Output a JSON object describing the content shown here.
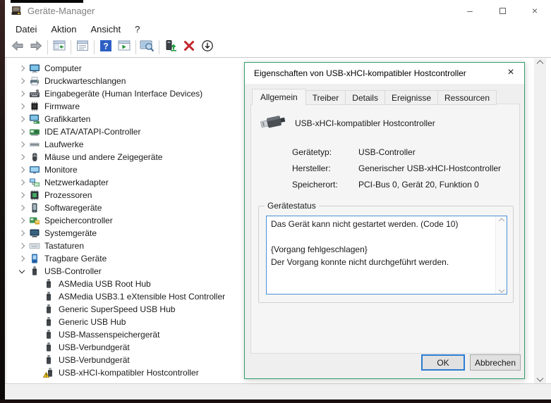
{
  "window": {
    "title": "Geräte-Manager",
    "controls": {
      "minimize": "–",
      "close": "×"
    }
  },
  "menu": {
    "items": [
      "Datei",
      "Aktion",
      "Ansicht",
      "?"
    ]
  },
  "toolbar": {
    "buttons": [
      {
        "type": "button",
        "icon": "back-icon"
      },
      {
        "type": "button",
        "icon": "forward-icon"
      },
      {
        "type": "separator"
      },
      {
        "type": "button",
        "icon": "show-hide-console-tree-icon"
      },
      {
        "type": "separator"
      },
      {
        "type": "button",
        "icon": "properties-icon"
      },
      {
        "type": "separator"
      },
      {
        "type": "button",
        "icon": "help-icon"
      },
      {
        "type": "button",
        "icon": "show-hide-action-pane-icon"
      },
      {
        "type": "separator"
      },
      {
        "type": "button",
        "icon": "scan-hardware-changes-icon"
      },
      {
        "type": "separator"
      },
      {
        "type": "button",
        "icon": "update-driver-icon"
      },
      {
        "type": "button",
        "icon": "uninstall-device-icon"
      },
      {
        "type": "button",
        "icon": "disable-device-icon"
      }
    ]
  },
  "tree": {
    "items": [
      {
        "label": "Computer",
        "icon": "computer-icon",
        "level": 0,
        "expanded": false
      },
      {
        "label": "Druckwarteschlangen",
        "icon": "printer-icon",
        "level": 0,
        "expanded": false
      },
      {
        "label": "Eingabegeräte (Human Interface Devices)",
        "icon": "hid-icon",
        "level": 0,
        "expanded": false
      },
      {
        "label": "Firmware",
        "icon": "firmware-chip-icon",
        "level": 0,
        "expanded": false
      },
      {
        "label": "Grafikkarten",
        "icon": "display-adapter-icon",
        "level": 0,
        "expanded": false
      },
      {
        "label": "IDE ATA/ATAPI-Controller",
        "icon": "ide-controller-icon",
        "level": 0,
        "expanded": false
      },
      {
        "label": "Laufwerke",
        "icon": "disk-drive-icon",
        "level": 0,
        "expanded": false
      },
      {
        "label": "Mäuse und andere Zeigegeräte",
        "icon": "mouse-icon",
        "level": 0,
        "expanded": false
      },
      {
        "label": "Monitore",
        "icon": "monitor-icon",
        "level": 0,
        "expanded": false
      },
      {
        "label": "Netzwerkadapter",
        "icon": "network-adapter-icon",
        "level": 0,
        "expanded": false
      },
      {
        "label": "Prozessoren",
        "icon": "processor-icon",
        "level": 0,
        "expanded": false
      },
      {
        "label": "Softwaregeräte",
        "icon": "software-device-icon",
        "level": 0,
        "expanded": false
      },
      {
        "label": "Speichercontroller",
        "icon": "storage-controller-icon",
        "level": 0,
        "expanded": false
      },
      {
        "label": "Systemgeräte",
        "icon": "system-device-icon",
        "level": 0,
        "expanded": false
      },
      {
        "label": "Tastaturen",
        "icon": "keyboard-icon",
        "level": 0,
        "expanded": false
      },
      {
        "label": "Tragbare Geräte",
        "icon": "portable-device-icon",
        "level": 0,
        "expanded": false
      },
      {
        "label": "USB-Controller",
        "icon": "usb-device-icon",
        "level": 0,
        "expanded": true
      },
      {
        "label": "ASMedia USB Root Hub",
        "icon": "usb-device-icon",
        "level": 1
      },
      {
        "label": "ASMedia USB3.1 eXtensible Host Controller",
        "icon": "usb-device-icon",
        "level": 1
      },
      {
        "label": "Generic SuperSpeed USB Hub",
        "icon": "usb-device-icon",
        "level": 1
      },
      {
        "label": "Generic USB Hub",
        "icon": "usb-device-icon",
        "level": 1
      },
      {
        "label": "USB-Massenspeichergerät",
        "icon": "usb-device-icon",
        "level": 1
      },
      {
        "label": "USB-Verbundgerät",
        "icon": "usb-device-icon",
        "level": 1
      },
      {
        "label": "USB-Verbundgerät",
        "icon": "usb-device-icon",
        "level": 1
      },
      {
        "label": "USB-xHCI-kompatibler Hostcontroller",
        "icon": "usb-warning-icon",
        "level": 1
      }
    ]
  },
  "dialog": {
    "title": "Eigenschaften von USB-xHCI-kompatibler Hostcontroller",
    "close_glyph": "×",
    "tabs": [
      {
        "label": "Allgemein",
        "active": true
      },
      {
        "label": "Treiber",
        "active": false
      },
      {
        "label": "Details",
        "active": false
      },
      {
        "label": "Ereignisse",
        "active": false
      },
      {
        "label": "Ressourcen",
        "active": false
      }
    ],
    "device_name": "USB-xHCI-kompatibler Hostcontroller",
    "device_icon": "usb-connector-icon",
    "fields": [
      {
        "label": "Gerätetyp:",
        "value": "USB-Controller"
      },
      {
        "label": "Hersteller:",
        "value": "Generischer USB-xHCI-Hostcontroller"
      },
      {
        "label": "Speicherort:",
        "value": "PCI-Bus 0, Gerät 20, Funktion 0"
      }
    ],
    "status_group_label": "Gerätestatus",
    "status_text": "Das Gerät kann nicht gestartet werden. (Code 10)\n\n{Vorgang fehlgeschlagen}\nDer Vorgang konnte nicht durchgeführt werden.",
    "ok_label": "OK",
    "cancel_label": "Abbrechen"
  },
  "colors": {
    "dialog_border_green": "#2f9e6b",
    "focus_blue": "#4a90d9",
    "default_button_blue": "#2b7cd3",
    "warning_yellow": "#ffd117",
    "uninstall_red": "#c4242c",
    "help_blue": "#2c5fc4",
    "title_text_gray": "#7f7f7f"
  }
}
